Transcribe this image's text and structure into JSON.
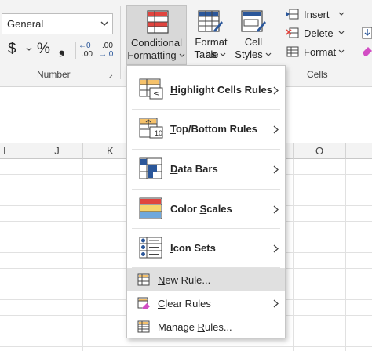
{
  "ribbon": {
    "number_format": "General",
    "number_group_label": "Number",
    "cells_group_label": "Cells",
    "format_symbols": {
      "currency": "$",
      "percent": "%",
      "comma": "❟",
      "inc_top": "←0",
      "inc_bottom": ".00",
      "dec_top": ".00",
      "dec_bottom": "→.0"
    },
    "conditional_formatting": {
      "line1": "Conditional",
      "line2": "Formatting"
    },
    "format_as_table": {
      "line1": "Format as",
      "line2": "Table"
    },
    "cell_styles": {
      "line1": "Cell",
      "line2": "Styles"
    },
    "insert": "Insert",
    "delete": "Delete",
    "format": "Format"
  },
  "columns": [
    "I",
    "J",
    "K",
    "O"
  ],
  "menu": {
    "items": [
      {
        "label": "Highlight Cells Rules",
        "icon": "highlight-cells-icon",
        "submenu": true
      },
      {
        "label": "Top/Bottom Rules",
        "icon": "top-bottom-icon",
        "submenu": true
      },
      {
        "label": "Data Bars",
        "icon": "data-bars-icon",
        "submenu": true
      },
      {
        "label": "Color Scales",
        "icon": "color-scales-icon",
        "submenu": true
      },
      {
        "label": "Icon Sets",
        "icon": "icon-sets-icon",
        "submenu": true
      },
      {
        "label": "New Rule...",
        "icon": "new-rule-icon",
        "submenu": false,
        "highlighted": true
      },
      {
        "label": "Clear Rules",
        "icon": "clear-rules-icon",
        "submenu": true
      },
      {
        "label": "Manage Rules...",
        "icon": "manage-rules-icon",
        "submenu": false
      }
    ],
    "top_bottom_badge": "10"
  },
  "colors": {
    "ribbon_bg": "#f3f3f3",
    "button_pressed": "#d8d8d8",
    "menu_highlight": "#e0e0e0",
    "accent_blue": "#2b579a",
    "accent_red": "#e0443e"
  }
}
